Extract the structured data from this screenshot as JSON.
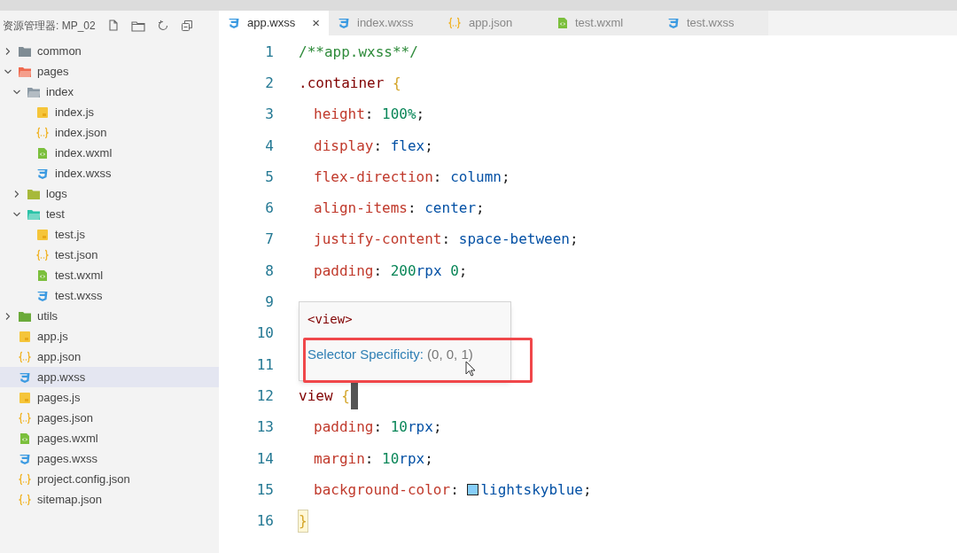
{
  "explorer": {
    "title": "资源管理器: MP_02"
  },
  "tree": [
    {
      "label": "common",
      "kind": "folder",
      "color": "#7f8c94",
      "expanded": false,
      "selected": false
    },
    {
      "label": "pages",
      "kind": "folder",
      "color": "#ef6a4f",
      "expanded": true,
      "selected": false,
      "children": [
        {
          "label": "index",
          "kind": "folder",
          "color": "#8a98a3",
          "expanded": true,
          "selected": false,
          "children": [
            {
              "label": "index.js",
              "kind": "js",
              "selected": false
            },
            {
              "label": "index.json",
              "kind": "json",
              "selected": false
            },
            {
              "label": "index.wxml",
              "kind": "wxml",
              "selected": false
            },
            {
              "label": "index.wxss",
              "kind": "wxss",
              "selected": false
            }
          ]
        },
        {
          "label": "logs",
          "kind": "folder",
          "color": "#a7b93a",
          "expanded": false,
          "selected": false
        },
        {
          "label": "test",
          "kind": "folder",
          "color": "#2bc3a8",
          "expanded": true,
          "selected": false,
          "children": [
            {
              "label": "test.js",
              "kind": "js",
              "selected": false
            },
            {
              "label": "test.json",
              "kind": "json",
              "selected": false
            },
            {
              "label": "test.wxml",
              "kind": "wxml",
              "selected": false
            },
            {
              "label": "test.wxss",
              "kind": "wxss",
              "selected": false
            }
          ]
        }
      ]
    },
    {
      "label": "utils",
      "kind": "folder",
      "color": "#6aaa3a",
      "expanded": false,
      "selected": false
    },
    {
      "label": "app.js",
      "kind": "js",
      "selected": false
    },
    {
      "label": "app.json",
      "kind": "json",
      "selected": false
    },
    {
      "label": "app.wxss",
      "kind": "wxss",
      "selected": true
    },
    {
      "label": "pages.js",
      "kind": "js",
      "selected": false
    },
    {
      "label": "pages.json",
      "kind": "json",
      "selected": false
    },
    {
      "label": "pages.wxml",
      "kind": "wxml",
      "selected": false
    },
    {
      "label": "pages.wxss",
      "kind": "wxss",
      "selected": false
    },
    {
      "label": "project.config.json",
      "kind": "json",
      "selected": false
    },
    {
      "label": "sitemap.json",
      "kind": "json",
      "selected": false
    }
  ],
  "tabs": [
    {
      "label": "app.wxss",
      "kind": "wxss",
      "selected": true,
      "close": "×"
    },
    {
      "label": "index.wxss",
      "kind": "wxss",
      "selected": false
    },
    {
      "label": "app.json",
      "kind": "json",
      "selected": false
    },
    {
      "label": "test.wxml",
      "kind": "wxml",
      "selected": false
    },
    {
      "label": "test.wxss",
      "kind": "wxss",
      "selected": false
    }
  ],
  "code_lines": [
    {
      "number": "1",
      "tokens": [
        {
          "kind": "comment",
          "text": "/**app.wxss**/"
        }
      ]
    },
    {
      "number": "2",
      "tokens": [
        {
          "kind": "selector",
          "text": ".container"
        },
        {
          "kind": "brace",
          "text": " {"
        }
      ]
    },
    {
      "number": "3",
      "tokens": [
        {
          "kind": "property",
          "text": "height"
        },
        {
          "kind": "plain",
          "text": ": "
        },
        {
          "kind": "number",
          "text": "100%"
        },
        {
          "kind": "plain",
          "text": ";"
        }
      ]
    },
    {
      "number": "4",
      "tokens": [
        {
          "kind": "property",
          "text": "display"
        },
        {
          "kind": "plain",
          "text": ": "
        },
        {
          "kind": "value",
          "text": "flex"
        },
        {
          "kind": "plain",
          "text": ";"
        }
      ]
    },
    {
      "number": "5",
      "tokens": [
        {
          "kind": "property",
          "text": "flex-direction"
        },
        {
          "kind": "plain",
          "text": ": "
        },
        {
          "kind": "value",
          "text": "column"
        },
        {
          "kind": "plain",
          "text": ";"
        }
      ]
    },
    {
      "number": "6",
      "tokens": [
        {
          "kind": "property",
          "text": "align-items"
        },
        {
          "kind": "plain",
          "text": ": "
        },
        {
          "kind": "value",
          "text": "center"
        },
        {
          "kind": "plain",
          "text": ";"
        }
      ]
    },
    {
      "number": "7",
      "tokens": [
        {
          "kind": "property",
          "text": "justify-content"
        },
        {
          "kind": "plain",
          "text": ": "
        },
        {
          "kind": "value",
          "text": "space-between"
        },
        {
          "kind": "plain",
          "text": ";"
        }
      ]
    },
    {
      "number": "8",
      "tokens": [
        {
          "kind": "property",
          "text": "padding"
        },
        {
          "kind": "plain",
          "text": ": "
        },
        {
          "kind": "number",
          "text": "200"
        },
        {
          "kind": "value",
          "text": "rpx"
        },
        {
          "kind": "number",
          "text": " 0"
        },
        {
          "kind": "plain",
          "text": ";"
        }
      ]
    },
    {
      "number": "9"
    },
    {
      "number": "10"
    },
    {
      "number": "11"
    },
    {
      "number": "12",
      "tokens": [
        {
          "kind": "tag",
          "text": "view"
        },
        {
          "kind": "brace",
          "text": " {"
        }
      ],
      "cursor": true
    },
    {
      "number": "13",
      "tokens": [
        {
          "kind": "property",
          "text": "padding"
        },
        {
          "kind": "plain",
          "text": ": "
        },
        {
          "kind": "number",
          "text": "10"
        },
        {
          "kind": "value",
          "text": "rpx"
        },
        {
          "kind": "plain",
          "text": ";"
        }
      ]
    },
    {
      "number": "14",
      "tokens": [
        {
          "kind": "property",
          "text": "margin"
        },
        {
          "kind": "plain",
          "text": ": "
        },
        {
          "kind": "number",
          "text": "10"
        },
        {
          "kind": "value",
          "text": "rpx"
        },
        {
          "kind": "plain",
          "text": ";"
        }
      ]
    },
    {
      "number": "15",
      "tokens": [
        {
          "kind": "property",
          "text": "background-color"
        },
        {
          "kind": "plain",
          "text": ": "
        },
        {
          "kind": "swatch",
          "color": "#87cefa"
        },
        {
          "kind": "value",
          "text": "lightskyblue"
        },
        {
          "kind": "plain",
          "text": ";"
        }
      ]
    },
    {
      "number": "16",
      "tokens": [
        {
          "kind": "brace",
          "text": "}",
          "matched": true
        }
      ]
    }
  ],
  "hover_tooltip": {
    "element": "<view>",
    "label": "Selector Specificity:",
    "value": "(0, 0, 1)",
    "highlighted": true
  }
}
